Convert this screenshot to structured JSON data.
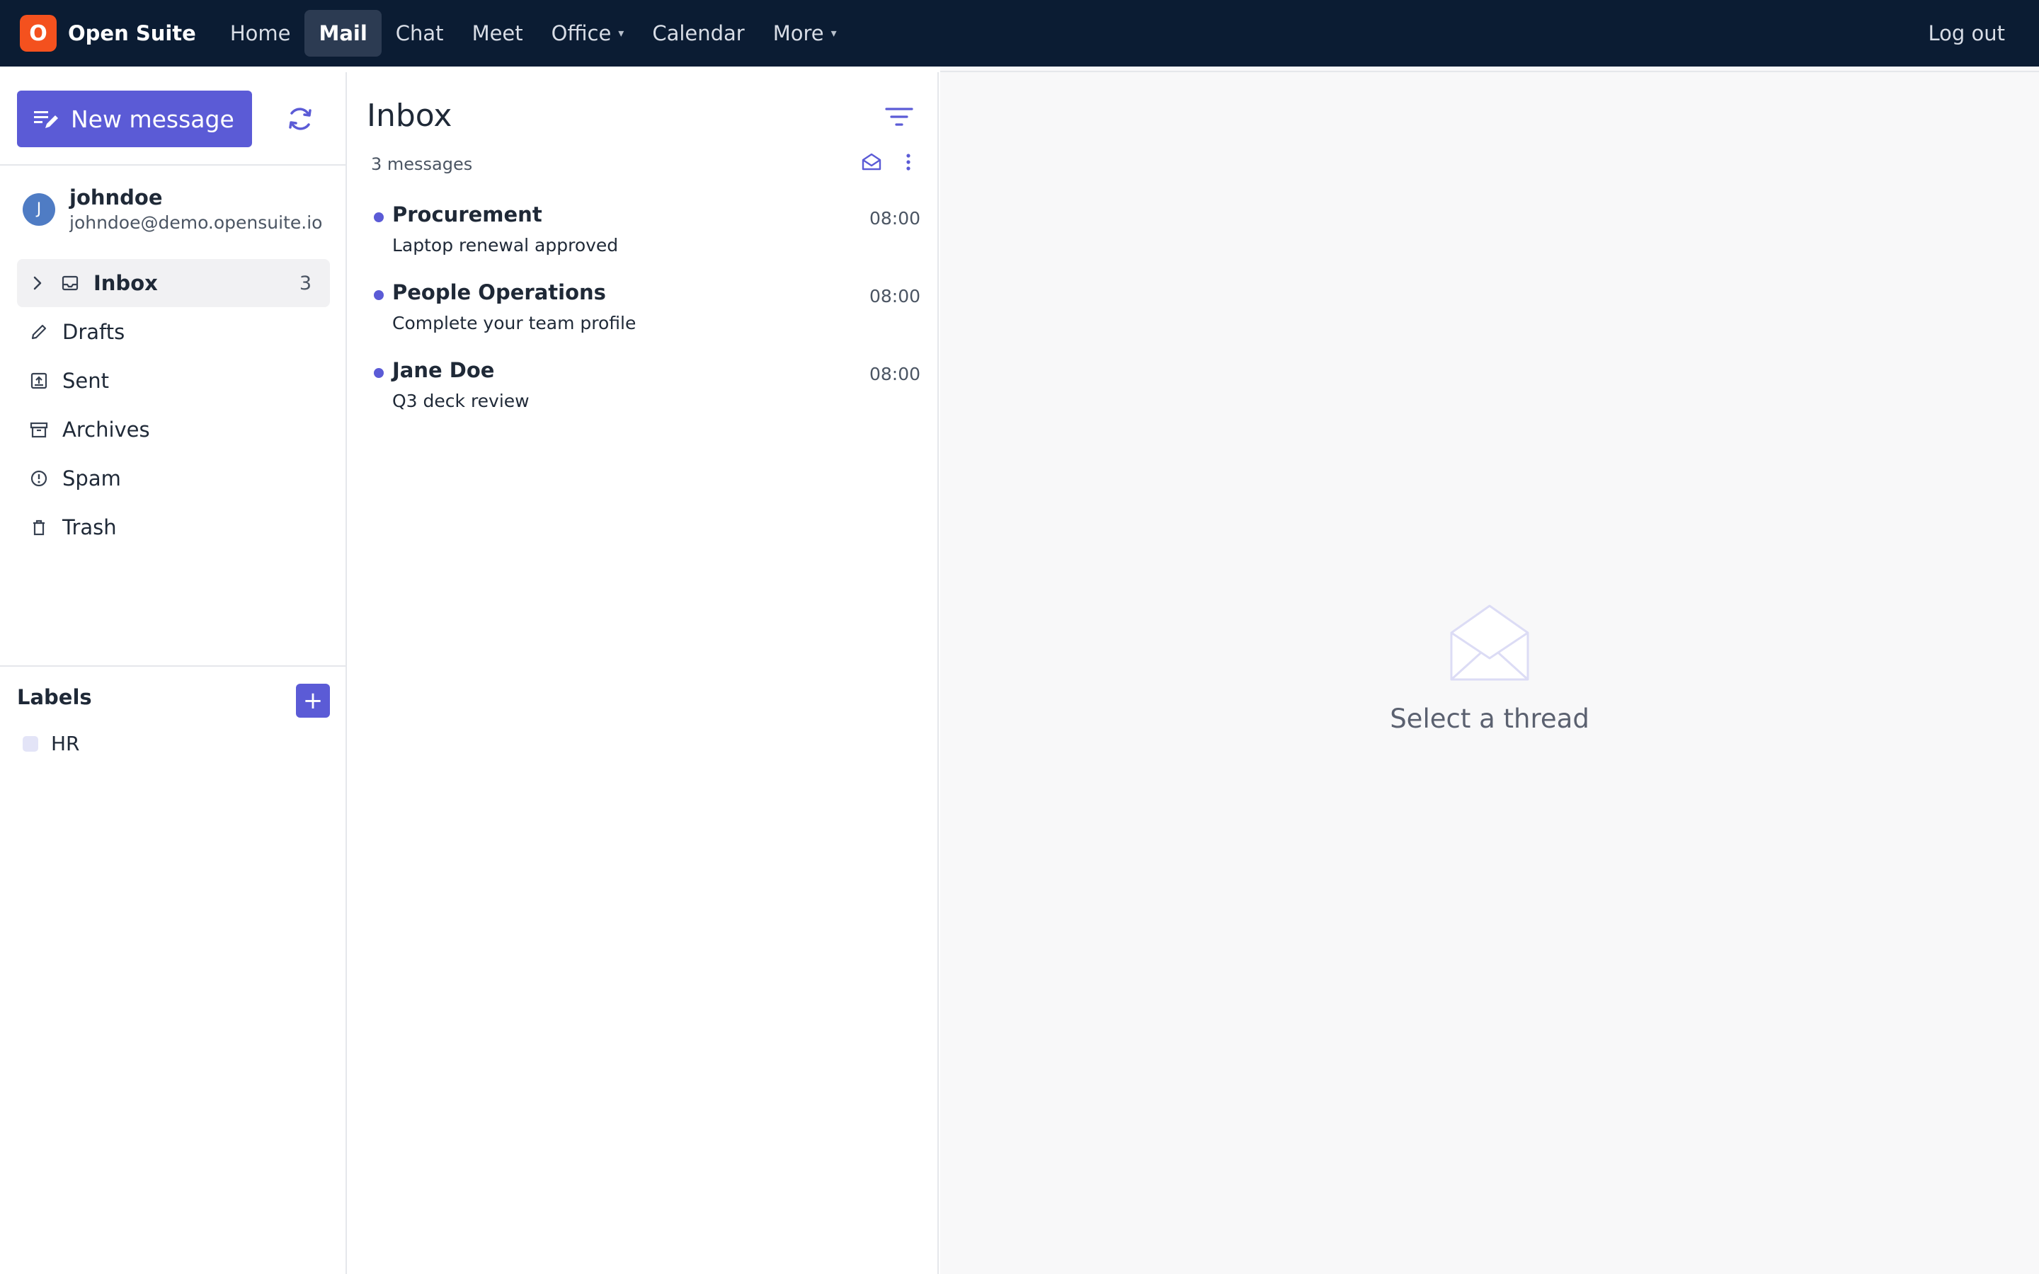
{
  "brand": {
    "logo_letter": "O",
    "name": "Open Suite",
    "color": "#f4511e"
  },
  "nav": {
    "items": [
      {
        "label": "Home"
      },
      {
        "label": "Mail",
        "active": true
      },
      {
        "label": "Chat"
      },
      {
        "label": "Meet"
      },
      {
        "label": "Office",
        "has_caret": true
      },
      {
        "label": "Calendar"
      },
      {
        "label": "More",
        "has_caret": true
      }
    ],
    "logout_label": "Log out",
    "caret": "▾"
  },
  "sidebar": {
    "new_message_label": "New message",
    "account": {
      "initial": "J",
      "name": "johndoe",
      "email": "johndoe@demo.opensuite.io"
    },
    "folders": [
      {
        "label": "Inbox",
        "icon": "inbox-icon",
        "count": "3",
        "selected": true
      },
      {
        "label": "Drafts",
        "icon": "pencil-icon"
      },
      {
        "label": "Sent",
        "icon": "sent-icon"
      },
      {
        "label": "Archives",
        "icon": "archive-icon"
      },
      {
        "label": "Spam",
        "icon": "spam-icon"
      },
      {
        "label": "Trash",
        "icon": "trash-icon"
      }
    ],
    "labels_title": "Labels",
    "labels_add": "+",
    "labels": [
      {
        "name": "HR",
        "color": "#e3e4f7"
      }
    ]
  },
  "list": {
    "title": "Inbox",
    "count_text": "3 messages",
    "threads": [
      {
        "sender": "Procurement",
        "subject": "Laptop renewal approved",
        "time": "08:00",
        "unread": true
      },
      {
        "sender": "People Operations",
        "subject": "Complete your team profile",
        "time": "08:00",
        "unread": true
      },
      {
        "sender": "Jane Doe",
        "subject": "Q3 deck review",
        "time": "08:00",
        "unread": true
      }
    ]
  },
  "pane": {
    "empty_text": "Select a thread"
  },
  "colors": {
    "accent": "#5b5bd6",
    "topbar": "#0b1c33"
  }
}
